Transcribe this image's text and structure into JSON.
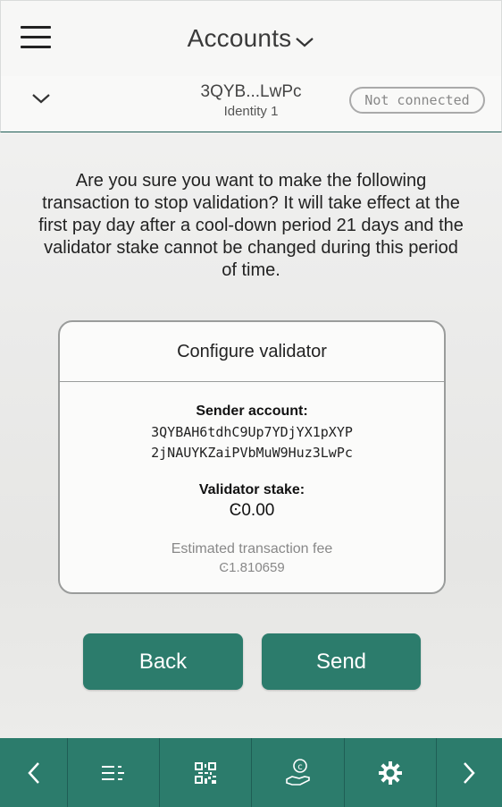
{
  "header": {
    "title": "Accounts",
    "menu_icon": "hamburger-menu-icon",
    "title_dropdown_icon": "chevron-down-icon"
  },
  "account": {
    "address_short": "3QYB...LwPc",
    "identity": "Identity 1",
    "status": "Not connected"
  },
  "main": {
    "question": "Are you sure you want to make the following transaction to stop validation? It will take effect at the first pay day after a cool-down period 21 days and the validator stake cannot be changed during this period of time."
  },
  "card": {
    "title": "Configure validator",
    "sender_label": "Sender account:",
    "sender_line1": "3QYBAH6tdhC9Up7YDjYX1pXYP",
    "sender_line2": "2jNAUYKZaiPVbMuW9Huz3LwPc",
    "stake_label": "Validator stake:",
    "stake_value": "Ͼ0.00",
    "fee_label": "Estimated transaction fee",
    "fee_value": "Ͼ1.810659"
  },
  "actions": {
    "back_label": "Back",
    "send_label": "Send"
  },
  "bottom_nav": {
    "items": [
      "chevron-left-icon",
      "list-icon",
      "qr-code-icon",
      "hand-coin-icon",
      "gear-icon",
      "chevron-right-icon"
    ]
  },
  "colors": {
    "accent": "#2c7c6c",
    "divider": "#1f5e55"
  }
}
